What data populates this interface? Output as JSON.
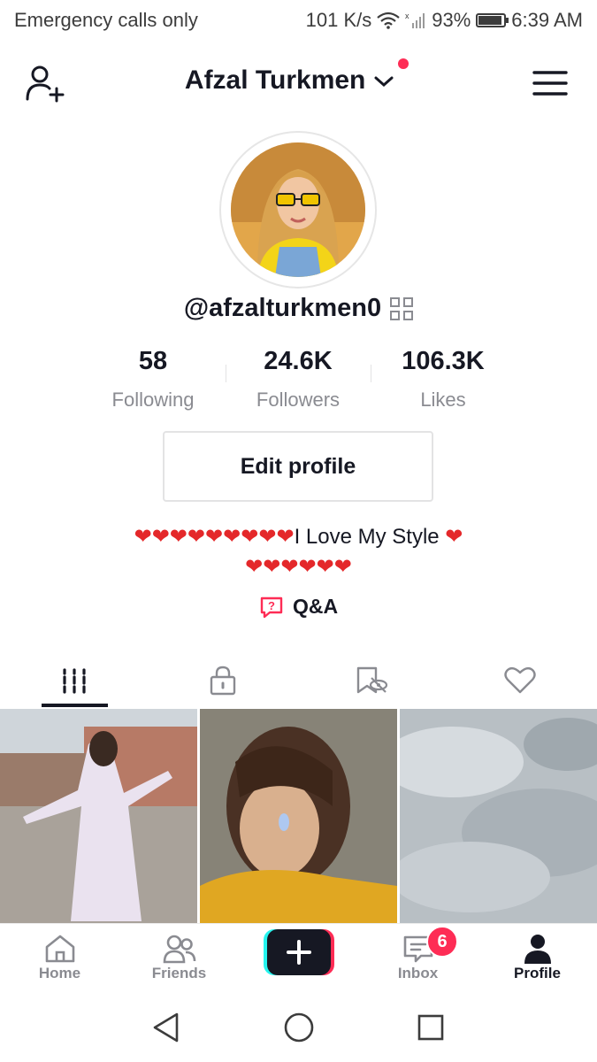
{
  "status_bar": {
    "carrier": "Emergency calls only",
    "speed": "101 K/s",
    "battery": "93%",
    "time": "6:39 AM"
  },
  "header": {
    "title": "Afzal Turkmen",
    "icons": [
      "add-friend-icon",
      "chevron-down-icon",
      "menu-icon"
    ]
  },
  "profile": {
    "username": "@afzalturkmen0",
    "stats": [
      {
        "value": "58",
        "label": "Following"
      },
      {
        "value": "24.6K",
        "label": "Followers"
      },
      {
        "value": "106.3K",
        "label": "Likes"
      }
    ],
    "edit_label": "Edit profile",
    "bio_line1_hearts": "❤❤❤❤❤❤❤❤❤",
    "bio_line1_text": "I Love My Style ",
    "bio_line1_end": "❤",
    "bio_line2": "❤❤❤❤❤❤",
    "qa_label": "Q&A"
  },
  "tabs": [
    "videos-grid-icon",
    "private-lock-icon",
    "favorites-hidden-icon",
    "liked-heart-icon"
  ],
  "bottom_nav": {
    "home": "Home",
    "friends": "Friends",
    "inbox": "Inbox",
    "profile": "Profile",
    "inbox_badge": "6"
  },
  "colors": {
    "accent": "#fe2c55",
    "text": "#161823",
    "muted": "#8a8b91",
    "heart": "#e4282a"
  }
}
